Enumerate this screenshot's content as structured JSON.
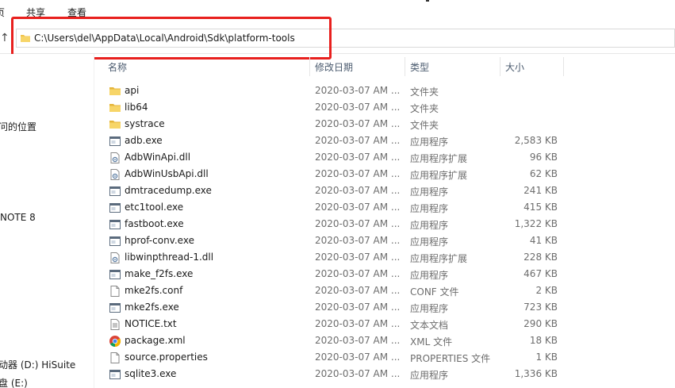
{
  "ribbon": {
    "tabs": [
      {
        "label": "页"
      },
      {
        "label": "共享"
      },
      {
        "label": "查看"
      }
    ]
  },
  "address_bar": {
    "path": "C:\\Users\\del\\AppData\\Local\\Android\\Sdk\\platform-tools"
  },
  "nav_pane": {
    "items": [
      {
        "label": "问的位置"
      },
      {
        "label": "NOTE 8"
      },
      {
        "label": "动器 (D:) HiSuite"
      },
      {
        "label": "盘 (E:)"
      }
    ]
  },
  "columns": {
    "name": "名称",
    "date": "修改日期",
    "type": "类型",
    "size": "大小"
  },
  "files": [
    {
      "name": "api",
      "date": "2020-03-07 AM ...",
      "type": "文件夹",
      "size": "",
      "icon": "folder-icon"
    },
    {
      "name": "lib64",
      "date": "2020-03-07 AM ...",
      "type": "文件夹",
      "size": "",
      "icon": "folder-icon"
    },
    {
      "name": "systrace",
      "date": "2020-03-07 AM ...",
      "type": "文件夹",
      "size": "",
      "icon": "folder-icon"
    },
    {
      "name": "adb.exe",
      "date": "2020-03-07 AM ...",
      "type": "应用程序",
      "size": "2,583 KB",
      "icon": "exe-icon"
    },
    {
      "name": "AdbWinApi.dll",
      "date": "2020-03-07 AM ...",
      "type": "应用程序扩展",
      "size": "96 KB",
      "icon": "dll-icon"
    },
    {
      "name": "AdbWinUsbApi.dll",
      "date": "2020-03-07 AM ...",
      "type": "应用程序扩展",
      "size": "62 KB",
      "icon": "dll-icon"
    },
    {
      "name": "dmtracedump.exe",
      "date": "2020-03-07 AM ...",
      "type": "应用程序",
      "size": "241 KB",
      "icon": "exe-icon"
    },
    {
      "name": "etc1tool.exe",
      "date": "2020-03-07 AM ...",
      "type": "应用程序",
      "size": "415 KB",
      "icon": "exe-icon"
    },
    {
      "name": "fastboot.exe",
      "date": "2020-03-07 AM ...",
      "type": "应用程序",
      "size": "1,322 KB",
      "icon": "exe-icon"
    },
    {
      "name": "hprof-conv.exe",
      "date": "2020-03-07 AM ...",
      "type": "应用程序",
      "size": "41 KB",
      "icon": "exe-icon"
    },
    {
      "name": "libwinpthread-1.dll",
      "date": "2020-03-07 AM ...",
      "type": "应用程序扩展",
      "size": "228 KB",
      "icon": "dll-icon"
    },
    {
      "name": "make_f2fs.exe",
      "date": "2020-03-07 AM ...",
      "type": "应用程序",
      "size": "467 KB",
      "icon": "exe-icon"
    },
    {
      "name": "mke2fs.conf",
      "date": "2020-03-07 AM ...",
      "type": "CONF 文件",
      "size": "2 KB",
      "icon": "file-icon"
    },
    {
      "name": "mke2fs.exe",
      "date": "2020-03-07 AM ...",
      "type": "应用程序",
      "size": "723 KB",
      "icon": "exe-icon"
    },
    {
      "name": "NOTICE.txt",
      "date": "2020-03-07 AM ...",
      "type": "文本文档",
      "size": "290 KB",
      "icon": "text-file-icon"
    },
    {
      "name": "package.xml",
      "date": "2020-03-07 AM ...",
      "type": "XML 文件",
      "size": "18 KB",
      "icon": "chrome-xml-icon"
    },
    {
      "name": "source.properties",
      "date": "2020-03-07 AM ...",
      "type": "PROPERTIES 文件",
      "size": "1 KB",
      "icon": "file-icon"
    },
    {
      "name": "sqlite3.exe",
      "date": "2020-03-07 AM ...",
      "type": "应用程序",
      "size": "1,336 KB",
      "icon": "exe-icon"
    }
  ],
  "colors": {
    "highlight": "#e8201e",
    "folder": "#f0c24b",
    "header_text": "#4a5a6e"
  }
}
